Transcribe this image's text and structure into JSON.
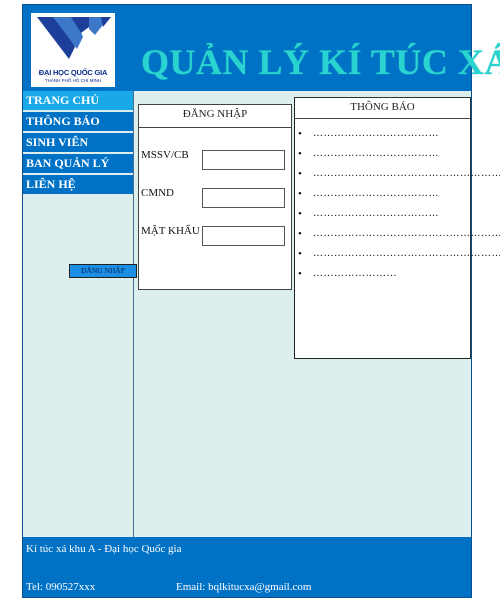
{
  "header": {
    "logo": {
      "name": "ĐẠI HỌC QUỐC GIA",
      "subtitle": "THÀNH PHỐ HỒ CHÍ MINH"
    },
    "title": "QUẢN LÝ KÍ TÚC XÁ"
  },
  "sidebar": {
    "items": [
      {
        "label": "TRANG CHỦ"
      },
      {
        "label": "THÔNG BÁO"
      },
      {
        "label": "SINH VIÊN"
      },
      {
        "label": "BAN QUẢN LÝ"
      },
      {
        "label": "LIÊN HỆ"
      }
    ]
  },
  "login": {
    "title": "ĐĂNG NHẬP",
    "mssv_label": "MSSV/CB",
    "cmnd_label": "CMND",
    "password_label": "MẬT KHẨU",
    "button": "ĐĂNG NHẬP"
  },
  "notices": {
    "title": "THÔNG BÁO",
    "items": [
      "………………………………",
      "………………………………",
      "…………………………………………………",
      "………………………………",
      "………………………………",
      "…………………………………………………",
      "……………………………………………………",
      "……………………"
    ]
  },
  "footer": {
    "address": "Kí túc xá khu A - Đại học Quốc gia",
    "tel": "Tel: 090527xxx",
    "email": "Email: bqlkitucxa@gmail.com"
  },
  "colors": {
    "primary": "#0072c6",
    "active": "#19a9e8",
    "title": "#29d3d0",
    "background": "#dcefee"
  }
}
